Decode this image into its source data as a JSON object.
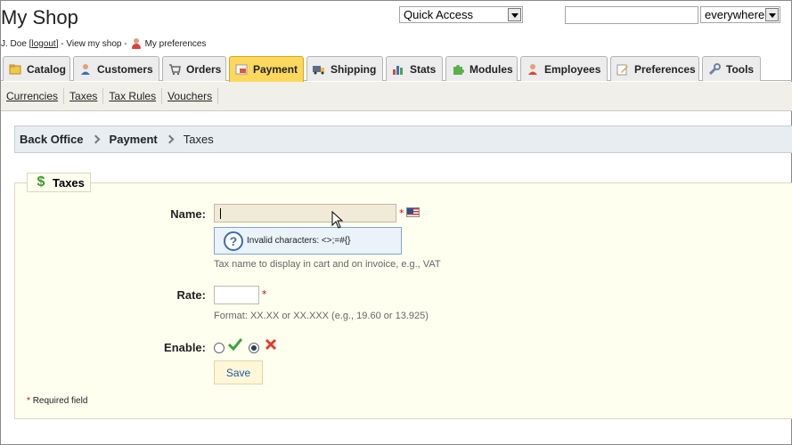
{
  "header": {
    "shop_title": "My Shop",
    "user_name": "J. Doe [",
    "logout": "logout",
    "view_shop": "] - View my shop -",
    "preferences": "My preferences",
    "quick_access": "Quick Access",
    "search_value": "",
    "search_scope": "everywhere"
  },
  "tabs": [
    {
      "label": "Catalog",
      "icon": "catalog-icon"
    },
    {
      "label": "Customers",
      "icon": "customers-icon"
    },
    {
      "label": "Orders",
      "icon": "orders-icon"
    },
    {
      "label": "Payment",
      "icon": "payment-icon",
      "active": true
    },
    {
      "label": "Shipping",
      "icon": "shipping-icon"
    },
    {
      "label": "Stats",
      "icon": "stats-icon"
    },
    {
      "label": "Modules",
      "icon": "modules-icon"
    },
    {
      "label": "Employees",
      "icon": "employees-icon"
    },
    {
      "label": "Preferences",
      "icon": "preferences-icon"
    },
    {
      "label": "Tools",
      "icon": "tools-icon"
    }
  ],
  "subnav": [
    "Currencies",
    "Taxes",
    "Tax Rules",
    "Vouchers"
  ],
  "breadcrumb": [
    "Back Office",
    "Payment",
    "Taxes"
  ],
  "form": {
    "legend": "Taxes",
    "name_label": "Name:",
    "name_value": "",
    "tooltip": "Invalid characters: <>;=#{}",
    "name_hint": "Tax name to display in cart and on invoice, e.g., VAT",
    "rate_label": "Rate:",
    "rate_value": "",
    "rate_hint": "Format: XX.XX or XX.XXX (e.g., 19.60 or 13.925)",
    "enable_label": "Enable:",
    "enable_selected": "no",
    "save_label": "Save",
    "required_note": "Required field",
    "required_star": "*"
  },
  "colors": {
    "active_tab": "#fdd85e",
    "form_bg": "#fffff0",
    "link_blue": "#1d5aa0",
    "required_red": "#cc0000"
  }
}
